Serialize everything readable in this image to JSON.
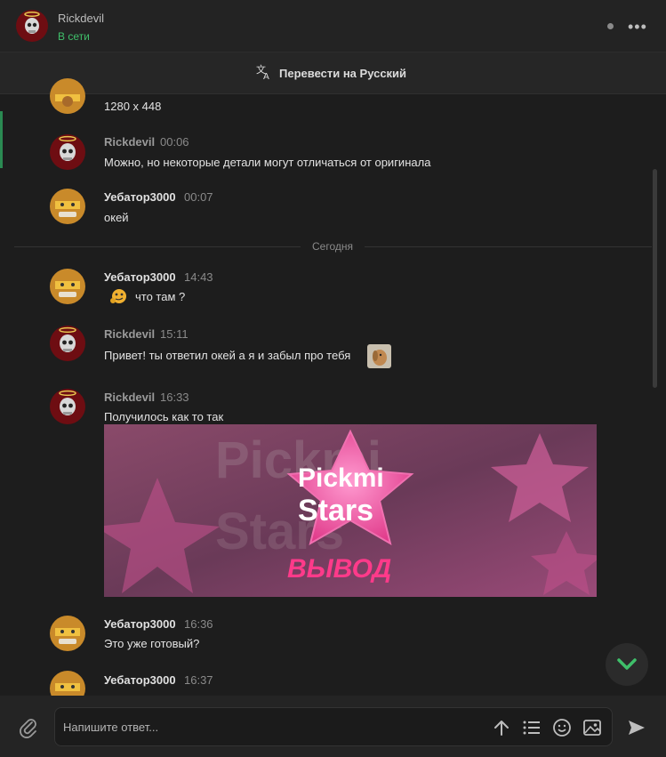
{
  "header": {
    "name": "Rickdevil",
    "status": "В сети",
    "more_label": "•••"
  },
  "translate": {
    "label": "Перевести на Русский"
  },
  "messages": [
    {
      "type": "continuation",
      "avatar": "warrior",
      "text": "1280 x 448"
    },
    {
      "author": "Rickdevil",
      "time": "00:06",
      "avatar": "skull",
      "text": "Можно, но некоторые детали могут отличаться от оригинала"
    },
    {
      "author": "Уебатор3000",
      "time": "00:07",
      "avatar": "warrior",
      "text": "окей"
    },
    {
      "author": "Уебатор3000",
      "time": "14:43",
      "avatar": "warrior",
      "text": "что там ?",
      "emoji": "thinking-emoji"
    },
    {
      "author": "Rickdevil",
      "time": "15:11",
      "avatar": "skull",
      "text": "Привет! ты ответил окей а я и забыл про тебя",
      "sticker": "dog-emoji"
    },
    {
      "author": "Rickdevil",
      "time": "16:33",
      "avatar": "skull",
      "text": "Получилось как то так"
    },
    {
      "author": "Уебатор3000",
      "time": "16:36",
      "avatar": "warrior",
      "text": "Это уже готовый?"
    },
    {
      "author": "Уебатор3000",
      "time": "16:37",
      "avatar": "warrior",
      "text": ""
    }
  ],
  "divider": {
    "label": "Сегодня"
  },
  "image": {
    "title_top": "Pickmi",
    "title_bottom": "Stars",
    "subtitle": "ВЫВОД",
    "bg_text_1": "Pickmi",
    "bg_text_2": "Stars"
  },
  "composer": {
    "placeholder": "Напишите ответ..."
  },
  "colors": {
    "accent": "#3fbf6a",
    "background": "#1d1d1d",
    "pink": "#e8509a"
  }
}
